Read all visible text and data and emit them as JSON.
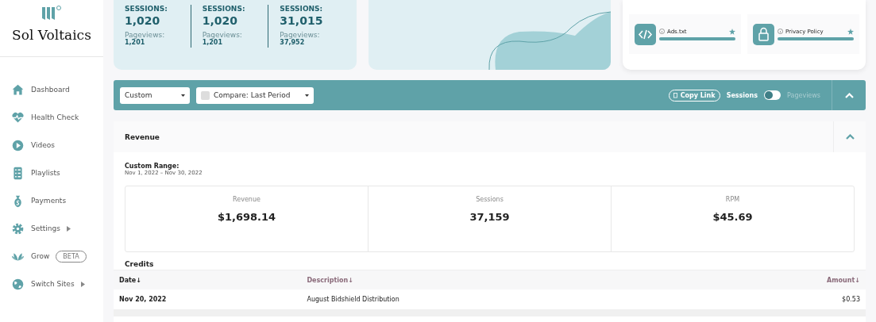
{
  "sidebar": {
    "site_name": "Sol Voltaics",
    "items": [
      {
        "label": "Dashboard",
        "kind": "home",
        "has_submenu": false
      },
      {
        "label": "Health Check",
        "kind": "heart",
        "has_submenu": false
      },
      {
        "label": "Videos",
        "kind": "play",
        "has_submenu": false
      },
      {
        "label": "Playlists",
        "kind": "list",
        "has_submenu": false
      },
      {
        "label": "Payments",
        "kind": "bag",
        "has_submenu": false
      },
      {
        "label": "Settings",
        "kind": "gear",
        "has_submenu": true
      },
      {
        "label": "Grow",
        "kind": "lotus",
        "has_submenu": false,
        "badge": "BETA"
      },
      {
        "label": "Switch Sites",
        "kind": "globe",
        "has_submenu": true
      }
    ]
  },
  "stats": [
    {
      "metric": "SESSIONS:",
      "value": "1,020",
      "sub_label": "Pageviews:",
      "sub_value": "1,201"
    },
    {
      "metric": "SESSIONS:",
      "value": "1,020",
      "sub_label": "Pageviews:",
      "sub_value": "1,201"
    },
    {
      "metric": "SESSIONS:",
      "value": "31,015",
      "sub_label": "Pageviews:",
      "sub_value": "37,952"
    }
  ],
  "health_items": [
    {
      "label": "Ads.txt",
      "kind": "code",
      "level": 1
    },
    {
      "label": "Privacy Policy",
      "kind": "lock",
      "level": 1
    }
  ],
  "toolbar": {
    "range": "Custom",
    "compare": {
      "label": "Compare: Last Period",
      "checked": false
    },
    "copy_link": "Copy Link",
    "toggle": {
      "left_label": "Sessions",
      "right_label": "Pageviews",
      "on": false
    }
  },
  "revenue": {
    "title": "Revenue",
    "range_label": "Custom Range:",
    "range": "Nov 1, 2022 – Nov 30, 2022",
    "metrics": [
      {
        "label": "Revenue",
        "value": "$1,698.14"
      },
      {
        "label": "Sessions",
        "value": "37,159"
      },
      {
        "label": "RPM",
        "value": "$45.69"
      }
    ],
    "credits_title": "Credits",
    "columns": [
      "Date↓",
      "Description↓",
      "Amount↓"
    ],
    "rows": [
      [
        "Nov 20, 2022",
        "August Bidshield Distribution",
        "$0.53"
      ]
    ]
  }
}
